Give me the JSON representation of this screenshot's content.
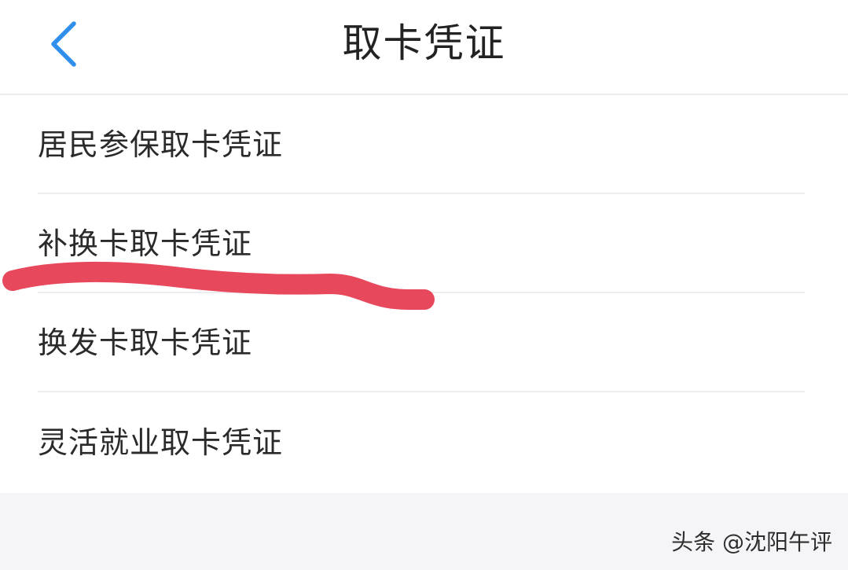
{
  "header": {
    "title": "取卡凭证",
    "back_icon": "chevron-left-icon",
    "accent_color": "#2f8fea"
  },
  "list": {
    "items": [
      {
        "label": "居民参保取卡凭证"
      },
      {
        "label": "补换卡取卡凭证"
      },
      {
        "label": "换发卡取卡凭证"
      },
      {
        "label": "灵活就业取卡凭证"
      }
    ]
  },
  "annotation": {
    "stroke_color": "#e8485c"
  },
  "watermark": {
    "text": "头条 @沈阳午评"
  }
}
